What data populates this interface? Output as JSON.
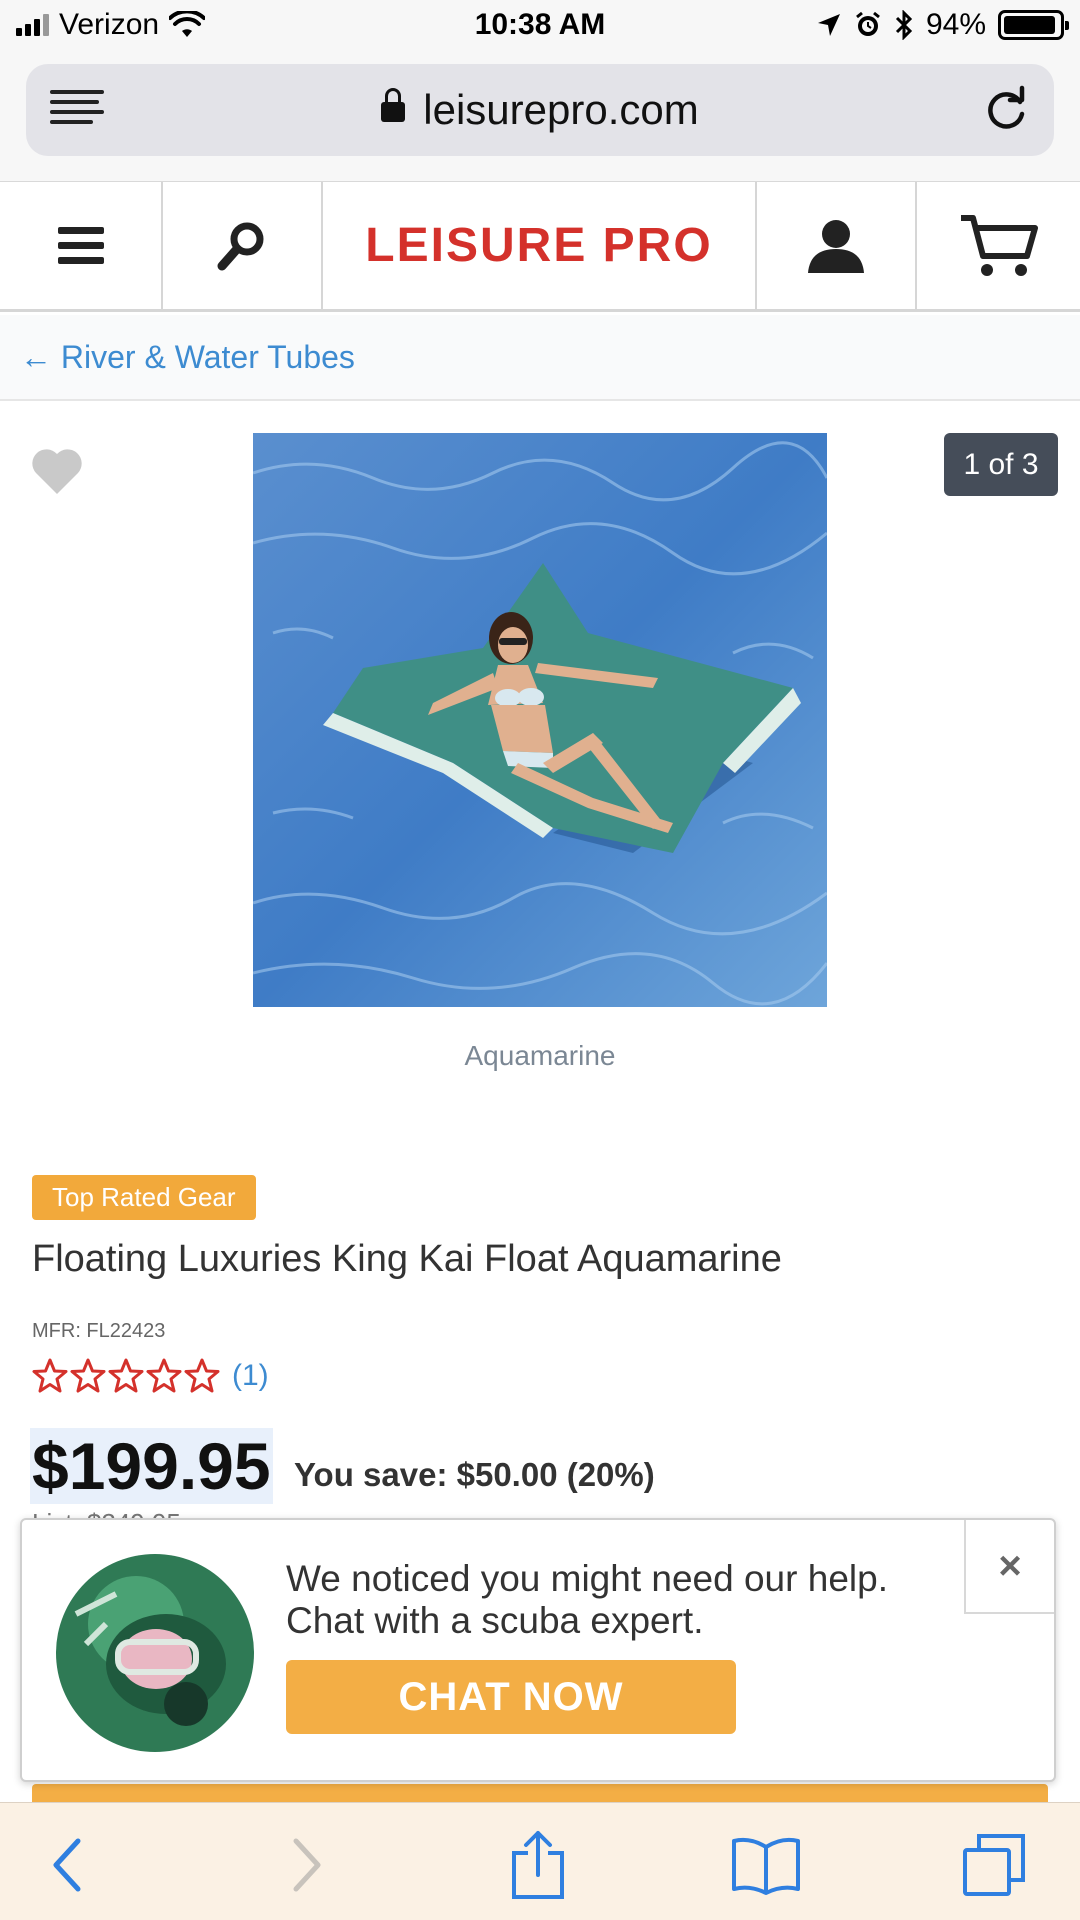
{
  "status_bar": {
    "carrier": "Verizon",
    "time": "10:38 AM",
    "battery_text": "94%",
    "battery_level": 0.94
  },
  "browser": {
    "url": "leisurepro.com"
  },
  "site": {
    "logo_text": "LEISURE PRO",
    "brand_color": "#d4312b",
    "breadcrumb": "← River & Water Tubes"
  },
  "product": {
    "image_counter": "1 of 3",
    "color_caption": "Aquamarine",
    "badge": "Top Rated Gear",
    "title": "Floating Luxuries King Kai Float Aquamarine",
    "mfr": "MFR: FL22423",
    "rating_stars": 5,
    "review_count": "(1)",
    "price": "$199.95",
    "savings": "You save: $50.00 (20%)",
    "list_price": "List: $249.95"
  },
  "chat_popup": {
    "message_line1": "We noticed you might need our help.",
    "message_line2": "Chat with a scuba expert.",
    "button_label": "CHAT NOW",
    "close_label": "×",
    "accent_color": "#f3ae45"
  },
  "icons": {
    "status": [
      "signal-icon",
      "wifi-icon",
      "location-icon",
      "alarm-icon",
      "bluetooth-icon",
      "battery-icon"
    ],
    "toolbar": [
      "back-icon",
      "forward-icon",
      "share-icon",
      "bookmarks-icon",
      "tabs-icon"
    ]
  }
}
